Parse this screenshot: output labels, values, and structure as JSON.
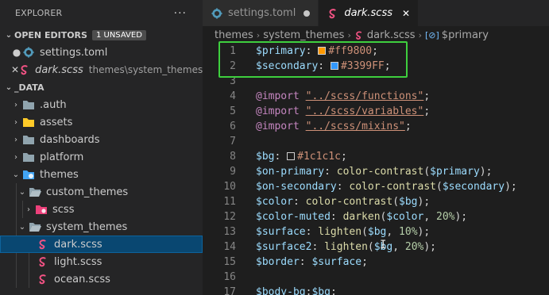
{
  "explorer": {
    "title": "EXPLORER",
    "more_icon": "ellipsis-icon",
    "open_editors": {
      "title": "OPEN EDITORS",
      "badge": "1 UNSAVED",
      "items": [
        {
          "marker": "●",
          "name": "settings.toml",
          "desc": "",
          "icon": "gear-icon"
        },
        {
          "marker": "✕",
          "name": "dark.scss",
          "desc": "themes\\system_themes",
          "icon": "sass-icon"
        }
      ]
    },
    "root": {
      "title": "_DATA",
      "tree": [
        {
          "label": ".auth",
          "chev": "›",
          "icon": "folder-icon"
        },
        {
          "label": "assets",
          "chev": "›",
          "icon": "folder-yellow-icon"
        },
        {
          "label": "dashboards",
          "chev": "›",
          "icon": "folder-icon"
        },
        {
          "label": "platform",
          "chev": "›",
          "icon": "folder-icon"
        },
        {
          "label": "themes",
          "chev": "⌄",
          "icon": "folder-theme-icon"
        },
        {
          "label": "custom_themes",
          "chev": "⌄",
          "icon": "folder-open-icon"
        },
        {
          "label": "scss",
          "chev": "›",
          "icon": "folder-sass-icon"
        },
        {
          "label": "system_themes",
          "chev": "⌄",
          "icon": "folder-open-icon"
        },
        {
          "label": "dark.scss",
          "chev": "",
          "icon": "sass-icon"
        },
        {
          "label": "light.scss",
          "chev": "",
          "icon": "sass-icon"
        },
        {
          "label": "ocean.scss",
          "chev": "",
          "icon": "sass-icon"
        }
      ]
    }
  },
  "tabs": [
    {
      "label": "settings.toml",
      "icon": "gear-icon",
      "state": "unsaved"
    },
    {
      "label": "dark.scss",
      "icon": "sass-icon",
      "state": "active"
    }
  ],
  "breadcrumb": [
    "themes",
    "system_themes",
    "dark.scss",
    "$primary"
  ],
  "code": {
    "line_numbers": [
      "1",
      "2",
      "3",
      "4",
      "5",
      "6",
      "7",
      "8",
      "9",
      "10",
      "11",
      "12",
      "13",
      "14",
      "15",
      "16",
      "17"
    ],
    "l1_var": "$primary",
    "l1_val": "#ff9800",
    "l1_color": "#ff9800",
    "l2_var": "$secondary",
    "l2_val": "#3399FF",
    "l2_color": "#3399ff",
    "import_kw": "@import",
    "import1": "\"../scss/functions\"",
    "import2": "\"../scss/variables\"",
    "import3": "\"../scss/mixins\"",
    "l8_var": "$bg",
    "l8_val": "#1c1c1c",
    "l8_color": "#1c1c1c",
    "l9_var": "$on-primary",
    "l9_fn": "color-contrast",
    "l9_arg": "$primary",
    "l10_var": "$on-secondary",
    "l10_fn": "color-contrast",
    "l10_arg": "$secondary",
    "l11_var": "$color",
    "l11_fn": "color-contrast",
    "l11_arg": "$bg",
    "l12_var": "$color-muted",
    "l12_fn": "darken",
    "l12_arg": "$color",
    "l12_num": "20%",
    "l13_var": "$surface",
    "l13_fn": "lighten",
    "l13_arg": "$bg",
    "l13_num": "10%",
    "l14_var": "$surface2",
    "l14_fn": "lighten",
    "l14_arg": "$bg",
    "l14_num": "20%",
    "l15_var": "$border",
    "l15_arg": "$surface",
    "l17_var": "$body-bg",
    "l17_arg": "$bg"
  }
}
